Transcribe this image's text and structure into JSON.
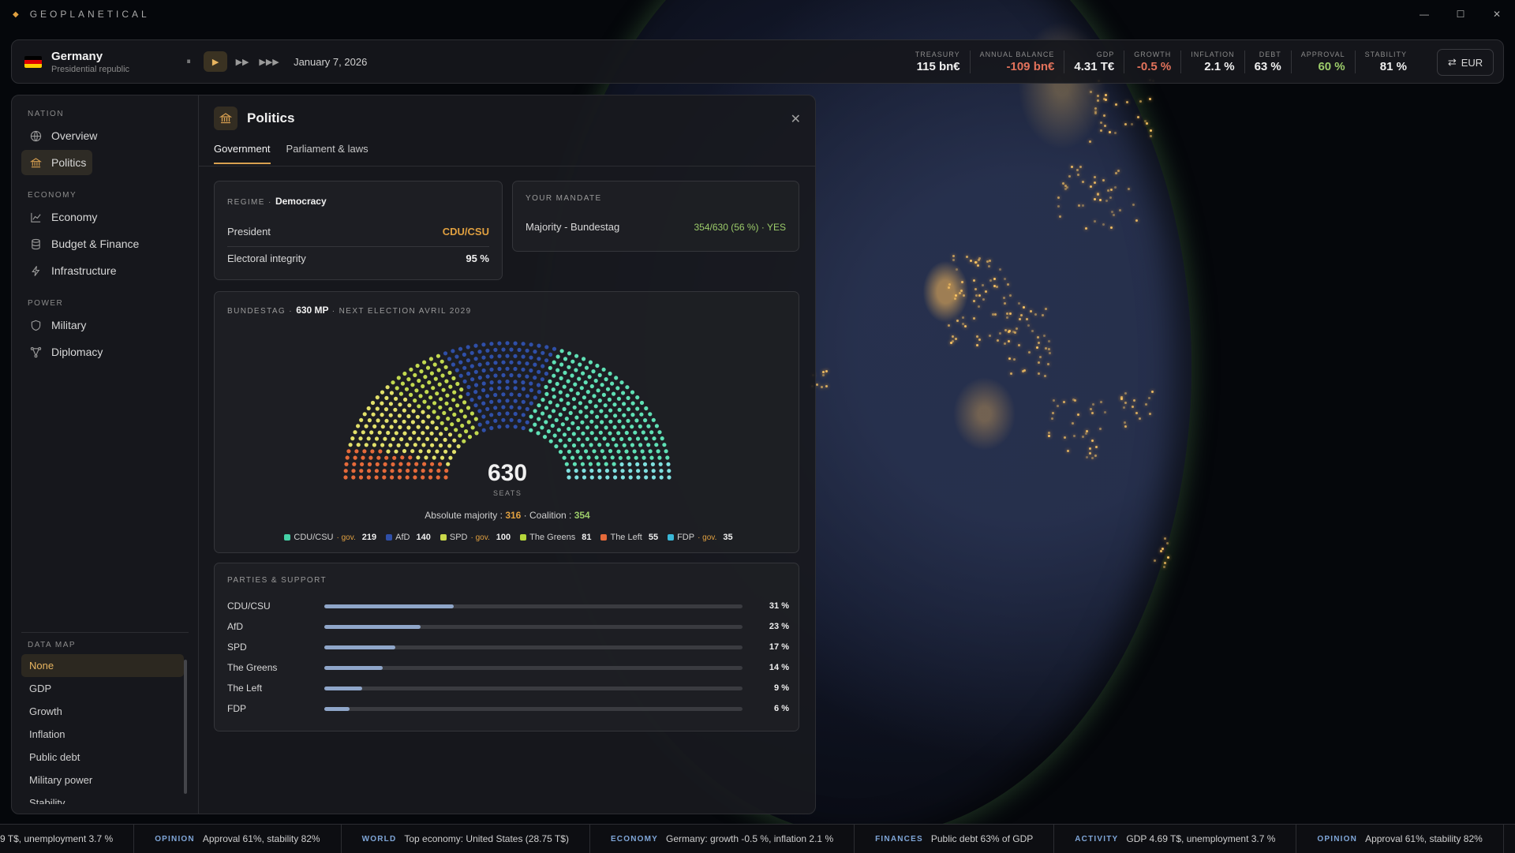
{
  "app": {
    "brand": "GEOPLANETICAL"
  },
  "topbar": {
    "country": "Germany",
    "regime": "Presidential republic",
    "flag_colors": [
      "#000000",
      "#dd0000",
      "#ffce00"
    ],
    "speed_buttons": [
      {
        "label": "⏸",
        "active": false
      },
      {
        "label": "▶",
        "active": true
      },
      {
        "label": "▶▶",
        "active": false
      },
      {
        "label": "▶▶▶",
        "active": false
      }
    ],
    "date": "January 7, 2026",
    "stats": [
      {
        "label": "TREASURY",
        "value": "115 bn€",
        "tone": "normal"
      },
      {
        "label": "ANNUAL BALANCE",
        "value": "-109 bn€",
        "tone": "neg"
      },
      {
        "label": "GDP",
        "value": "4.31 T€",
        "tone": "normal"
      },
      {
        "label": "GROWTH",
        "value": "-0.5 %",
        "tone": "neg"
      },
      {
        "label": "INFLATION",
        "value": "2.1 %",
        "tone": "normal"
      },
      {
        "label": "DEBT",
        "value": "63 %",
        "tone": "normal"
      },
      {
        "label": "APPROVAL",
        "value": "60 %",
        "tone": "pos"
      },
      {
        "label": "STABILITY",
        "value": "81 %",
        "tone": "normal"
      }
    ],
    "currency": "EUR"
  },
  "sidebar": {
    "sections": [
      {
        "title": "NATION",
        "items": [
          {
            "label": "Overview",
            "icon": "globe-icon",
            "active": false
          },
          {
            "label": "Politics",
            "icon": "institution-icon",
            "active": true
          }
        ]
      },
      {
        "title": "ECONOMY",
        "items": [
          {
            "label": "Economy",
            "icon": "line-chart-icon",
            "active": false
          },
          {
            "label": "Budget & Finance",
            "icon": "database-icon",
            "active": false
          },
          {
            "label": "Infrastructure",
            "icon": "lightning-icon",
            "active": false
          }
        ]
      },
      {
        "title": "POWER",
        "items": [
          {
            "label": "Military",
            "icon": "shield-icon",
            "active": false
          },
          {
            "label": "Diplomacy",
            "icon": "network-icon",
            "active": false
          }
        ]
      }
    ],
    "datamap_title": "DATA MAP",
    "datamap_items": [
      "None",
      "GDP",
      "Growth",
      "Inflation",
      "Public debt",
      "Military power",
      "Stability"
    ],
    "datamap_active": "None"
  },
  "politics": {
    "title": "Politics",
    "tabs": [
      {
        "label": "Government",
        "active": true
      },
      {
        "label": "Parliament & laws",
        "active": false
      }
    ],
    "regime_label": "REGIME",
    "regime_value": "Democracy",
    "president_label": "President",
    "president_value": "CDU/CSU",
    "integrity_label": "Electoral integrity",
    "integrity_value": "95 %",
    "mandate_title": "YOUR MANDATE",
    "mandate_label": "Majority - Bundestag",
    "mandate_value": "354/630 (56 %) · YES",
    "bundestag_label": "BUNDESTAG",
    "bundestag_mp": "630 MP",
    "bundestag_election": "NEXT ELECTION AVRIL 2029",
    "seats_total": "630",
    "seats_label": "SEATS",
    "majority_text_prefix": "Absolute majority : ",
    "majority_value": "316",
    "coalition_text_prefix": " · Coalition : ",
    "coalition_value": "354",
    "gov_label": "· gov.",
    "parties": [
      {
        "name": "CDU/CSU",
        "seats": 219,
        "gov": true,
        "color": "#45d1a6"
      },
      {
        "name": "AfD",
        "seats": 140,
        "gov": false,
        "color": "#2f4fa8"
      },
      {
        "name": "SPD",
        "seats": 100,
        "gov": true,
        "color": "#c9d84a"
      },
      {
        "name": "The Greens",
        "seats": 81,
        "gov": false,
        "color": "#b5d63a"
      },
      {
        "name": "The Left",
        "seats": 55,
        "gov": false,
        "color": "#e56a3a"
      },
      {
        "name": "FDP",
        "seats": 35,
        "gov": true,
        "color": "#3ab8d8"
      }
    ],
    "hemicycle_order": [
      {
        "name": "The Left",
        "seats": 55,
        "color": "#e56a3a"
      },
      {
        "name": "SPD",
        "seats": 100,
        "color": "#e2e06a"
      },
      {
        "name": "The Greens",
        "seats": 81,
        "color": "#c2d94f"
      },
      {
        "name": "AfD",
        "seats": 140,
        "color": "#2f4fa8"
      },
      {
        "name": "CDU/CSU",
        "seats": 219,
        "color": "#5fe0b5"
      },
      {
        "name": "FDP",
        "seats": 35,
        "color": "#7fe0e0"
      }
    ],
    "support_title": "PARTIES & SUPPORT",
    "support": [
      {
        "name": "CDU/CSU",
        "pct": 31,
        "label": "31 %"
      },
      {
        "name": "AfD",
        "pct": 23,
        "label": "23 %"
      },
      {
        "name": "SPD",
        "pct": 17,
        "label": "17 %"
      },
      {
        "name": "The Greens",
        "pct": 14,
        "label": "14 %"
      },
      {
        "name": "The Left",
        "pct": 9,
        "label": "9 %"
      },
      {
        "name": "FDP",
        "pct": 6,
        "label": "6 %"
      }
    ]
  },
  "ticker": [
    {
      "tag": "",
      "text": "9 T$, unemployment 3.7 %"
    },
    {
      "tag": "OPINION",
      "text": "Approval 61%, stability 82%"
    },
    {
      "tag": "WORLD",
      "text": "Top economy: United States (28.75 T$)"
    },
    {
      "tag": "ECONOMY",
      "text": "Germany: growth -0.5 %, inflation 2.1 %"
    },
    {
      "tag": "FINANCES",
      "text": "Public debt 63% of GDP"
    },
    {
      "tag": "ACTIVITY",
      "text": "GDP 4.69 T$, unemployment 3.7 %"
    },
    {
      "tag": "OPINION",
      "text": "Approval 61%, stability 82%"
    }
  ]
}
